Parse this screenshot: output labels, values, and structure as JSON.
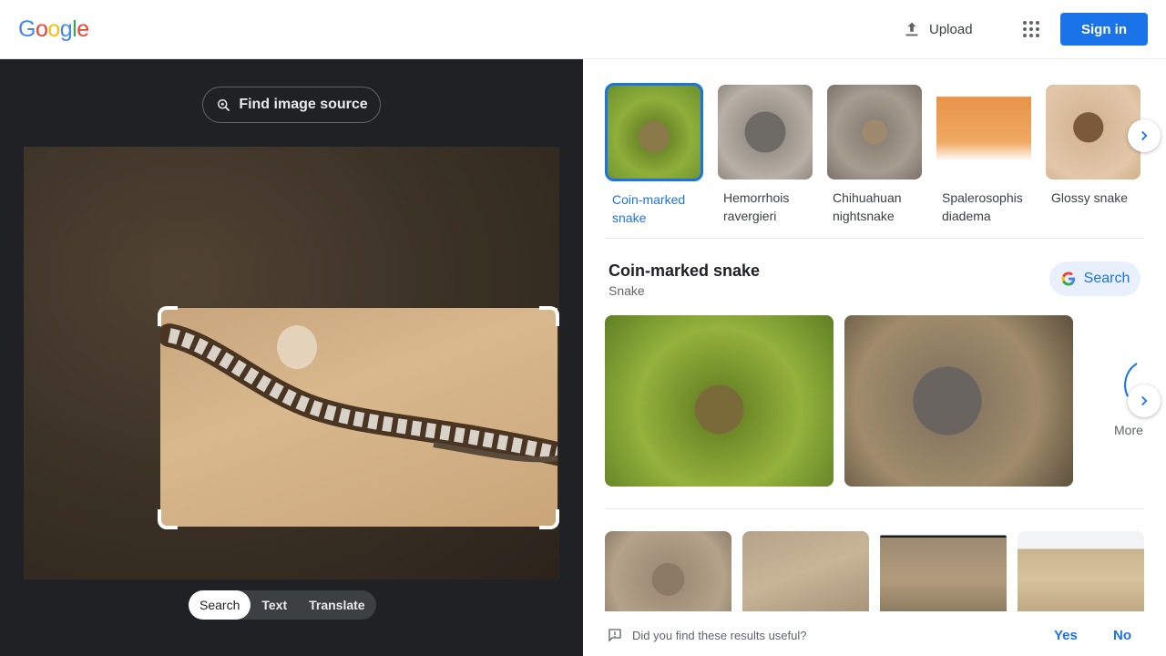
{
  "header": {
    "logo_letters": [
      {
        "ch": "G",
        "color": "#4285F4"
      },
      {
        "ch": "o",
        "color": "#EA4335"
      },
      {
        "ch": "o",
        "color": "#FBBC05"
      },
      {
        "ch": "g",
        "color": "#4285F4"
      },
      {
        "ch": "l",
        "color": "#34A853"
      },
      {
        "ch": "e",
        "color": "#EA4335"
      }
    ],
    "upload_label": "Upload",
    "signin_label": "Sign in"
  },
  "left_panel": {
    "find_source_label": "Find image source",
    "modes": [
      "Search",
      "Text",
      "Translate"
    ],
    "active_mode": "Search"
  },
  "matches": [
    {
      "label": "Coin-marked snake",
      "selected": true
    },
    {
      "label": "Hemorrhois ravergieri",
      "selected": false
    },
    {
      "label": "Chihuahuan nightsnake",
      "selected": false
    },
    {
      "label": "Spalerosophis diadema",
      "selected": false
    },
    {
      "label": "Glossy snake",
      "selected": false
    }
  ],
  "knowledge": {
    "title": "Coin-marked snake",
    "subtitle": "Snake",
    "search_label": "Search",
    "more_label": "More"
  },
  "feedback": {
    "question": "Did you find these results useful?",
    "yes_label": "Yes",
    "no_label": "No"
  },
  "colors": {
    "accent": "#1a73e8",
    "dark_panel": "#202124"
  }
}
